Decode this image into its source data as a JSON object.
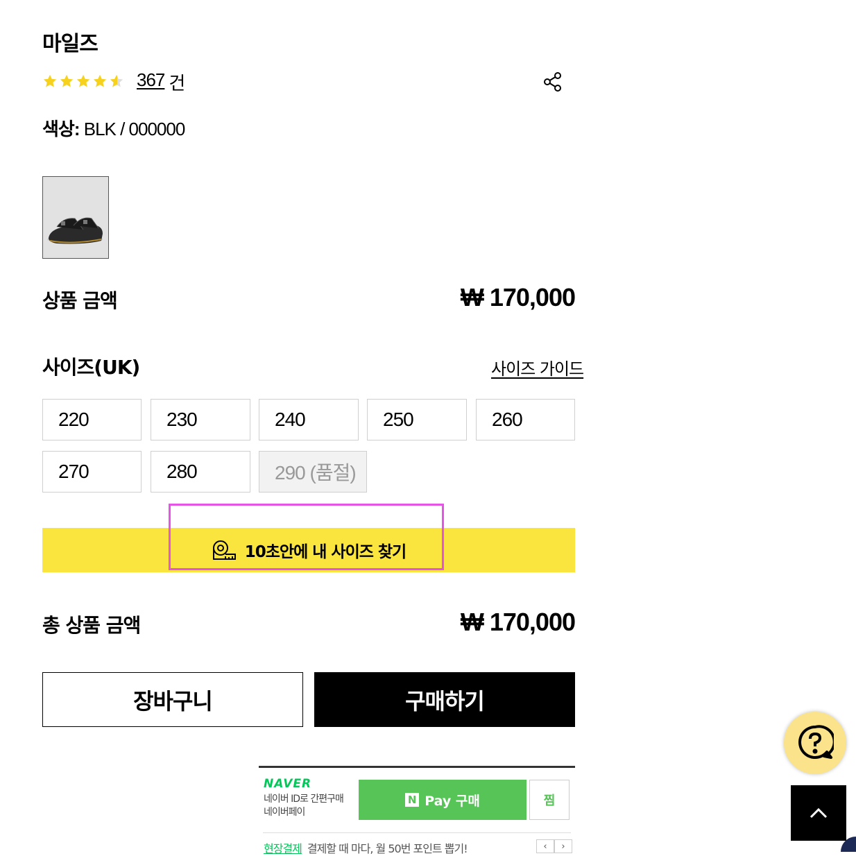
{
  "product": {
    "name": "마일즈",
    "rating": 4.6,
    "review_count": "367",
    "review_unit": "건",
    "color_label": "색상:",
    "color_value": "BLK / 000000"
  },
  "price_row": {
    "label": "상품 금액",
    "value": "₩ 170,000"
  },
  "size_section": {
    "label": "사이즈(UK)",
    "guide_link": "사이즈 가이드",
    "sizes": [
      "220",
      "230",
      "240",
      "250",
      "260",
      "270",
      "280",
      "290 (품절)"
    ],
    "find_button": "10초안에 내 사이즈 찾기"
  },
  "total_row": {
    "label": "총 상품 금액",
    "value": "₩ 170,000"
  },
  "actions": {
    "cart": "장바구니",
    "buy": "구매하기"
  },
  "naver": {
    "logo": "NAVER",
    "sub_line1": "네이버 ID로 간편구매",
    "sub_line2": "네이버페이",
    "pay_n": "N",
    "pay_label": "Pay 구매",
    "zzim": "찜",
    "promo_highlight": "현장결제",
    "promo_text": "결제할 때 마다, 월 50번 포인트 뽑기!",
    "prev": "‹",
    "next": "›"
  },
  "colors": {
    "accent_yellow": "#fae53f",
    "naver_green": "#57c458",
    "highlight": "#e654e6"
  },
  "icons": [
    "star-icon",
    "share-icon",
    "tape-measure-icon",
    "help-chat-icon",
    "chevron-up-icon"
  ]
}
